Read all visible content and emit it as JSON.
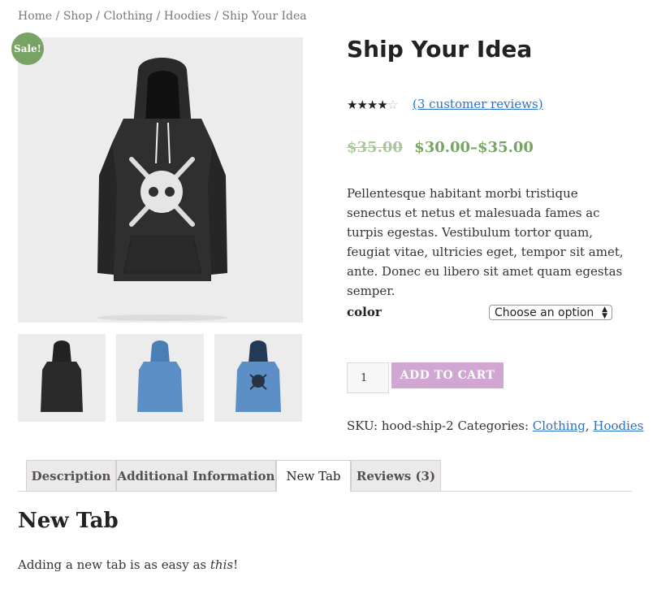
{
  "breadcrumb": {
    "items": [
      "Home",
      "Shop",
      "Clothing",
      "Hoodies"
    ],
    "current": "Ship Your Idea",
    "separator": "/"
  },
  "gallery": {
    "sale_badge": "Sale!",
    "thumbnails": [
      "black hoodie back",
      "blue hoodie back",
      "blue hoodie front"
    ]
  },
  "product": {
    "title": "Ship Your Idea",
    "rating": 4,
    "rating_max": 5,
    "reviews_link": "(3 customer reviews)",
    "old_price": "$35.00",
    "price": "$30.00–$35.00",
    "description": "Pellentesque habitant morbi tristique senectus et netus et malesuada fames ac turpis egestas. Vestibulum tortor quam, feugiat vitae, ultricies eget, tempor sit amet, ante. Donec eu libero sit amet quam egestas semper.",
    "color_label": "color",
    "color_select": "Choose an option",
    "quantity": "1",
    "add_to_cart": "ADD TO CART",
    "sku_label": "SKU:",
    "sku": "hood-ship-2",
    "categories_label": "Categories:",
    "categories": [
      "Clothing",
      "Hoodies"
    ]
  },
  "tabs": {
    "items": [
      "Description",
      "Additional Information",
      "New Tab",
      "Reviews (3)"
    ],
    "active": "New Tab"
  },
  "panel": {
    "title": "New Tab",
    "text_before": "Adding a new tab is as easy as ",
    "text_em": "this",
    "text_after": "!"
  },
  "colors": {
    "sale": "#77a464",
    "price": "#77a464",
    "old_price": "#aac79b",
    "add_to_cart": "#d2a6d2",
    "link": "#2b72c6"
  }
}
